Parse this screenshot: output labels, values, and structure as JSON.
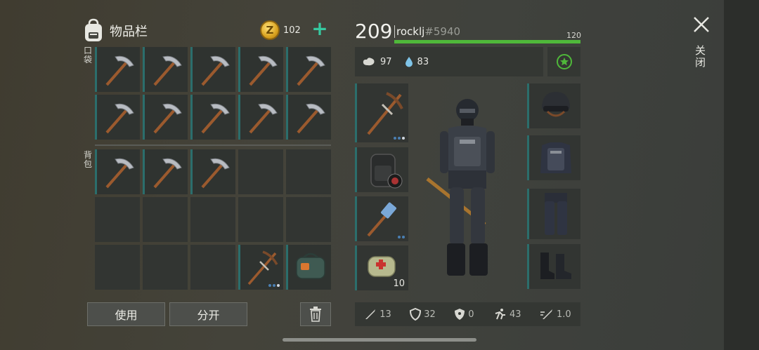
{
  "inventory": {
    "title": "物品栏",
    "coins": "102",
    "coin_symbol": "Z",
    "add_icon": "plus-icon",
    "pocket_label": "口袋",
    "backpack_label": "背包",
    "pocket_items": [
      "pickaxe",
      "pickaxe",
      "pickaxe",
      "pickaxe",
      "pickaxe",
      "pickaxe",
      "pickaxe",
      "pickaxe",
      "pickaxe",
      "pickaxe"
    ],
    "backpack_items": [
      "pickaxe",
      "pickaxe",
      "pickaxe",
      "empty",
      "empty",
      "empty",
      "empty",
      "empty",
      "empty",
      "empty",
      "empty",
      "empty",
      "empty",
      "crafted-pickaxe",
      "medkit-bag"
    ],
    "use_button": "使用",
    "split_button": "分开",
    "trash_icon": "trash-icon"
  },
  "player": {
    "level": "209",
    "name": "rocklj",
    "tag": "#5940",
    "hp_max": "120",
    "food": "97",
    "water": "83"
  },
  "equipment": {
    "weapon": "crafted-pickaxe",
    "backpack": "tactical-backpack",
    "tool": "hammer",
    "bag": "first-aid-bag",
    "bag_count": "10",
    "helmet": "riot-helmet",
    "armor": "police-vest",
    "pants": "tactical-pants",
    "boots": "combat-boots"
  },
  "combat_stats": {
    "damage": "13",
    "defense": "32",
    "radiation": "0",
    "speed": "43",
    "attack_speed": "1.0"
  },
  "close": {
    "label": "关闭",
    "icon": "close-icon"
  },
  "colors": {
    "slot_accent": "#2b6e6c",
    "hp_bar": "#4fb83a",
    "add_green": "#36c9a0",
    "coin_gold": "#d9a320"
  }
}
